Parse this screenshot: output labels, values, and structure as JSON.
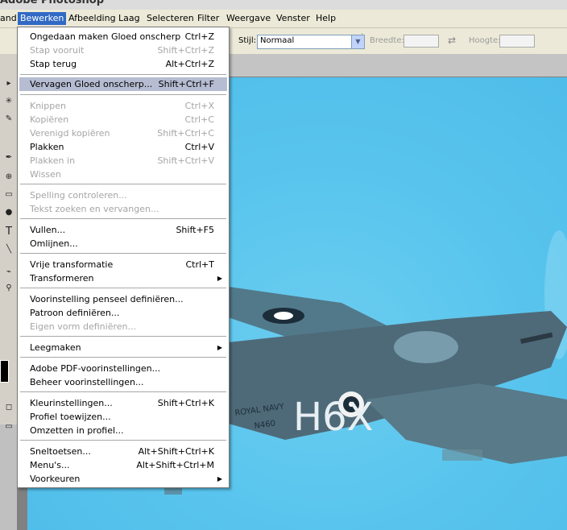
{
  "app": {
    "title": "Adobe Photoshop"
  },
  "menubar": {
    "items": [
      {
        "label": "and"
      },
      {
        "label": "Bewerken",
        "active": true
      },
      {
        "label": "Afbeelding"
      },
      {
        "label": "Laag"
      },
      {
        "label": "Selecteren"
      },
      {
        "label": "Filter"
      },
      {
        "label": "Weergave"
      },
      {
        "label": "Venster"
      },
      {
        "label": "Help"
      }
    ]
  },
  "options": {
    "style_label": "Stijl:",
    "style_value": "Normaal",
    "width_label": "Breedte:",
    "height_label": "Hoogte:"
  },
  "edit_menu": {
    "items": [
      {
        "label": "Ongedaan maken Gloed onscherp",
        "shortcut": "Ctrl+Z",
        "enabled": true
      },
      {
        "label": "Stap vooruit",
        "shortcut": "Shift+Ctrl+Z",
        "enabled": false
      },
      {
        "label": "Stap terug",
        "shortcut": "Alt+Ctrl+Z",
        "enabled": true
      },
      {
        "label": "Vervagen Gloed onscherp...",
        "shortcut": "Shift+Ctrl+F",
        "enabled": true,
        "highlighted": true
      },
      {
        "label": "Knippen",
        "shortcut": "Ctrl+X",
        "enabled": false
      },
      {
        "label": "Kopiëren",
        "shortcut": "Ctrl+C",
        "enabled": false
      },
      {
        "label": "Verenigd kopiëren",
        "shortcut": "Shift+Ctrl+C",
        "enabled": false
      },
      {
        "label": "Plakken",
        "shortcut": "Ctrl+V",
        "enabled": true
      },
      {
        "label": "Plakken in",
        "shortcut": "Shift+Ctrl+V",
        "enabled": false
      },
      {
        "label": "Wissen",
        "shortcut": "",
        "enabled": false
      },
      {
        "label": "Spelling controleren...",
        "shortcut": "",
        "enabled": false
      },
      {
        "label": "Tekst zoeken en vervangen...",
        "shortcut": "",
        "enabled": false
      },
      {
        "label": "Vullen...",
        "shortcut": "Shift+F5",
        "enabled": true
      },
      {
        "label": "Omlijnen...",
        "shortcut": "",
        "enabled": true
      },
      {
        "label": "Vrije transformatie",
        "shortcut": "Ctrl+T",
        "enabled": true
      },
      {
        "label": "Transformeren",
        "shortcut": "",
        "enabled": true,
        "submenu": true
      },
      {
        "label": "Voorinstelling penseel definiëren...",
        "shortcut": "",
        "enabled": true
      },
      {
        "label": "Patroon definiëren...",
        "shortcut": "",
        "enabled": true
      },
      {
        "label": "Eigen vorm definiëren...",
        "shortcut": "",
        "enabled": false
      },
      {
        "label": "Leegmaken",
        "shortcut": "",
        "enabled": true,
        "submenu": true
      },
      {
        "label": "Adobe PDF-voorinstellingen...",
        "shortcut": "",
        "enabled": true
      },
      {
        "label": "Beheer voorinstellingen...",
        "shortcut": "",
        "enabled": true
      },
      {
        "label": "Kleurinstellingen...",
        "shortcut": "Shift+Ctrl+K",
        "enabled": true
      },
      {
        "label": "Profiel toewijzen...",
        "shortcut": "",
        "enabled": true
      },
      {
        "label": "Omzetten in profiel...",
        "shortcut": "",
        "enabled": true
      },
      {
        "label": "Sneltoetsen...",
        "shortcut": "Alt+Shift+Ctrl+K",
        "enabled": true
      },
      {
        "label": "Menu's...",
        "shortcut": "Alt+Shift+Ctrl+M",
        "enabled": true
      },
      {
        "label": "Voorkeuren",
        "shortcut": "",
        "enabled": true,
        "submenu": true
      }
    ]
  },
  "canvas": {
    "aircraft_lettering": "H6X",
    "fuselage_text_1": "ROYAL NAVY",
    "fuselage_text_2": "N460",
    "background_color": "#59c5ee"
  },
  "toolbox": {
    "type_tool_glyph": "T"
  }
}
